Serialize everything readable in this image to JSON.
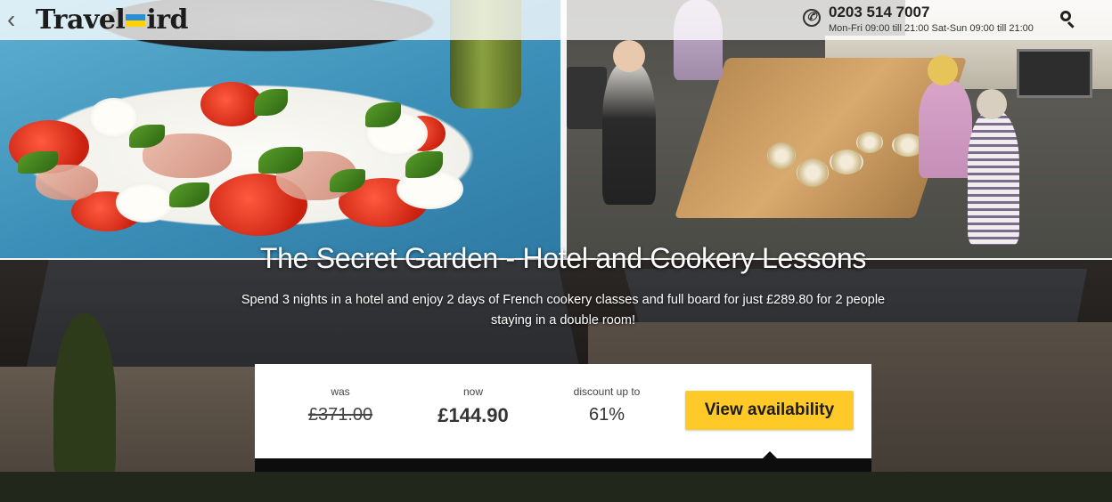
{
  "header": {
    "back_icon": "chevron-left-icon",
    "logo_text_left": "Travel",
    "logo_text_right": "ird",
    "phone_icon_glyph": "✆",
    "phone_number": "0203 514 7007",
    "phone_hours": "Mon-Fri 09:00 till 21:00 Sat-Sun 09:00 till 21:00",
    "search_icon": "search-icon"
  },
  "hero": {
    "title": "The Secret Garden - Hotel and Cookery Lessons",
    "description_line1": "Spend 3 nights in a hotel and enjoy 2 days of French cookery classes and full board for just £289.80 for 2 people",
    "description_line2": "staying in a double room!"
  },
  "pricing": {
    "was_label": "was",
    "was_value": "£371.00",
    "now_label": "now",
    "now_value": "£144.90",
    "discount_label": "discount up to",
    "discount_value": "61%",
    "cta_label": "View availability"
  },
  "colors": {
    "cta": "#ffc928",
    "logo_blue": "#2b8fd6",
    "logo_yellow": "#ffd200"
  }
}
